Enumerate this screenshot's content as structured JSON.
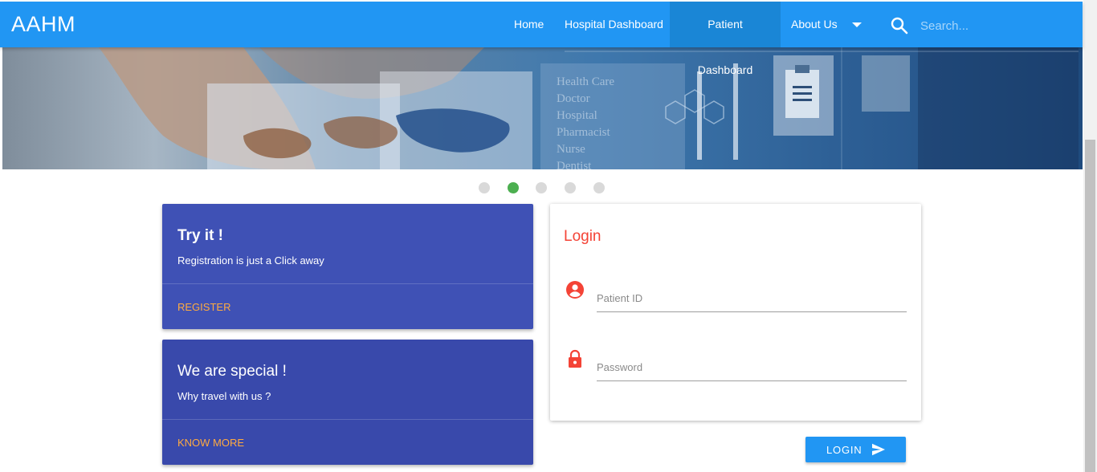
{
  "navbar": {
    "brand": "AAHM",
    "items": [
      {
        "label": "Home"
      },
      {
        "label": "Hospital Dashboard"
      },
      {
        "label": "Patient Dashboard",
        "active": true
      },
      {
        "label": "About Us"
      }
    ],
    "dropdown_icon": "caret-down-icon",
    "search": {
      "icon": "search-icon",
      "placeholder": "Search..."
    }
  },
  "carousel": {
    "slide_words": [
      "Health Care",
      "Doctor",
      "Hospital",
      "Pharmacist",
      "Nurse",
      "Dentist"
    ],
    "indicator_count": 5,
    "active_index": 1,
    "active_color": "#4caf50"
  },
  "cards": [
    {
      "title": "Try it !",
      "subtitle": "Registration is just a Click away",
      "action": "REGISTER"
    },
    {
      "title": "We are special !",
      "subtitle": "Why travel with us ?",
      "action": "KNOW MORE"
    }
  ],
  "login": {
    "title": "Login",
    "patient_id_placeholder": "Patient ID",
    "patient_id_icon": "account-circle-icon",
    "password_placeholder": "Password",
    "password_icon": "lock-icon",
    "button_label": "LOGIN",
    "button_icon": "send-icon"
  },
  "colors": {
    "primary": "#2196f3",
    "card1": "#3f51b5",
    "card2": "#3949ab",
    "accent": "#ffab40",
    "login_title": "#f44336"
  }
}
